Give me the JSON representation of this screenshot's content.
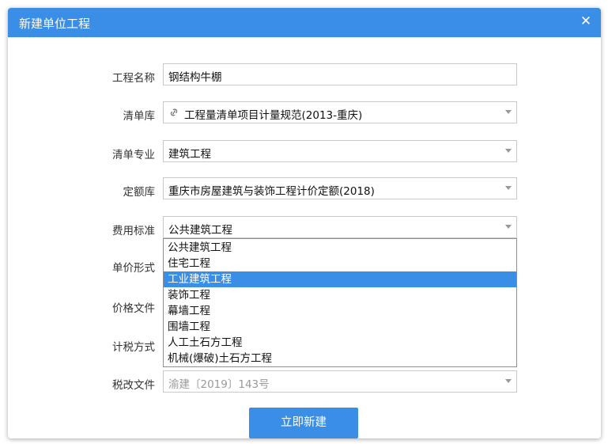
{
  "dialog": {
    "title": "新建单位工程",
    "close_icon": "close-icon",
    "accent_color": "#3a8ee6"
  },
  "form": {
    "project_name": {
      "label": "工程名称",
      "value": "钢结构牛棚"
    },
    "bill_library": {
      "label": "清单库",
      "value": "工程量清单项目计量规范(2013-重庆)",
      "icon": "link-icon"
    },
    "bill_specialty": {
      "label": "清单专业",
      "value": "建筑工程"
    },
    "quota_library": {
      "label": "定额库",
      "value": "重庆市房屋建筑与装饰工程计价定额(2018)"
    },
    "fee_standard": {
      "label": "费用标准",
      "value": "公共建筑工程"
    },
    "unit_price_form": {
      "label": "单价形式"
    },
    "price_file": {
      "label": "价格文件"
    },
    "tax_method": {
      "label": "计税方式"
    },
    "tax_reform_file": {
      "label": "税改文件",
      "value": "渝建〔2019〕143号"
    }
  },
  "fee_standard_options": [
    {
      "label": "公共建筑工程",
      "selected": false
    },
    {
      "label": "住宅工程",
      "selected": false
    },
    {
      "label": "工业建筑工程",
      "selected": true
    },
    {
      "label": "装饰工程",
      "selected": false
    },
    {
      "label": "幕墙工程",
      "selected": false
    },
    {
      "label": "围墙工程",
      "selected": false
    },
    {
      "label": "人工土石方工程",
      "selected": false
    },
    {
      "label": "机械(爆破)土石方工程",
      "selected": false
    }
  ],
  "actions": {
    "create_label": "立即新建"
  }
}
